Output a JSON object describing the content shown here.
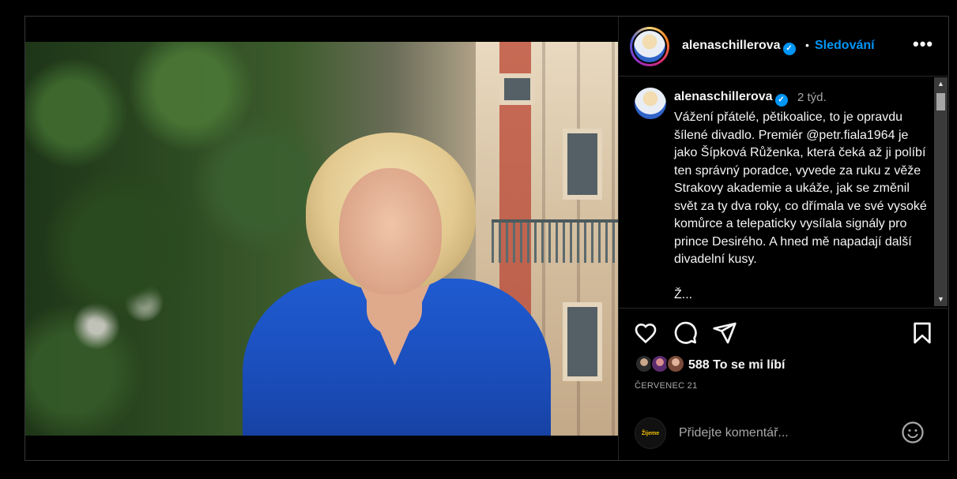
{
  "post": {
    "username": "alenaschillerova",
    "follow_label": "Sledování",
    "separator": "•",
    "more_label": "•••",
    "verified_mark": "✓"
  },
  "caption": {
    "username": "alenaschillerova",
    "time": "2 týd.",
    "text": "Vážení přátelé, pětikoalice, to je opravdu šílené divadlo. Premiér @petr.fiala1964 je jako Šípková Růženka, která čeká až ji políbí ten správný poradce, vyvede za ruku z věže Strakovy akademie a ukáže, jak se změnil svět za ty dva roky, co dřímala ve své vysoké komůrce a telepaticky vysílala signály pro prince Desirého. A hned mě napadají další divadelní kusy.\n\nŽ..."
  },
  "actions": {
    "icons": [
      "heart-icon",
      "comment-icon",
      "share-icon",
      "bookmark-icon"
    ],
    "likes_text": "588 To se mi líbí",
    "date": "ČERVENEC 21"
  },
  "comment": {
    "placeholder": "Přidejte komentář...",
    "avatar_label": "Žijeme trhem"
  },
  "scrollbar": {
    "up": "▲",
    "down": "▼"
  },
  "colors": {
    "accent": "#0095f6",
    "background": "#000000",
    "text": "#f5f5f5",
    "muted": "#a8a8a8"
  }
}
